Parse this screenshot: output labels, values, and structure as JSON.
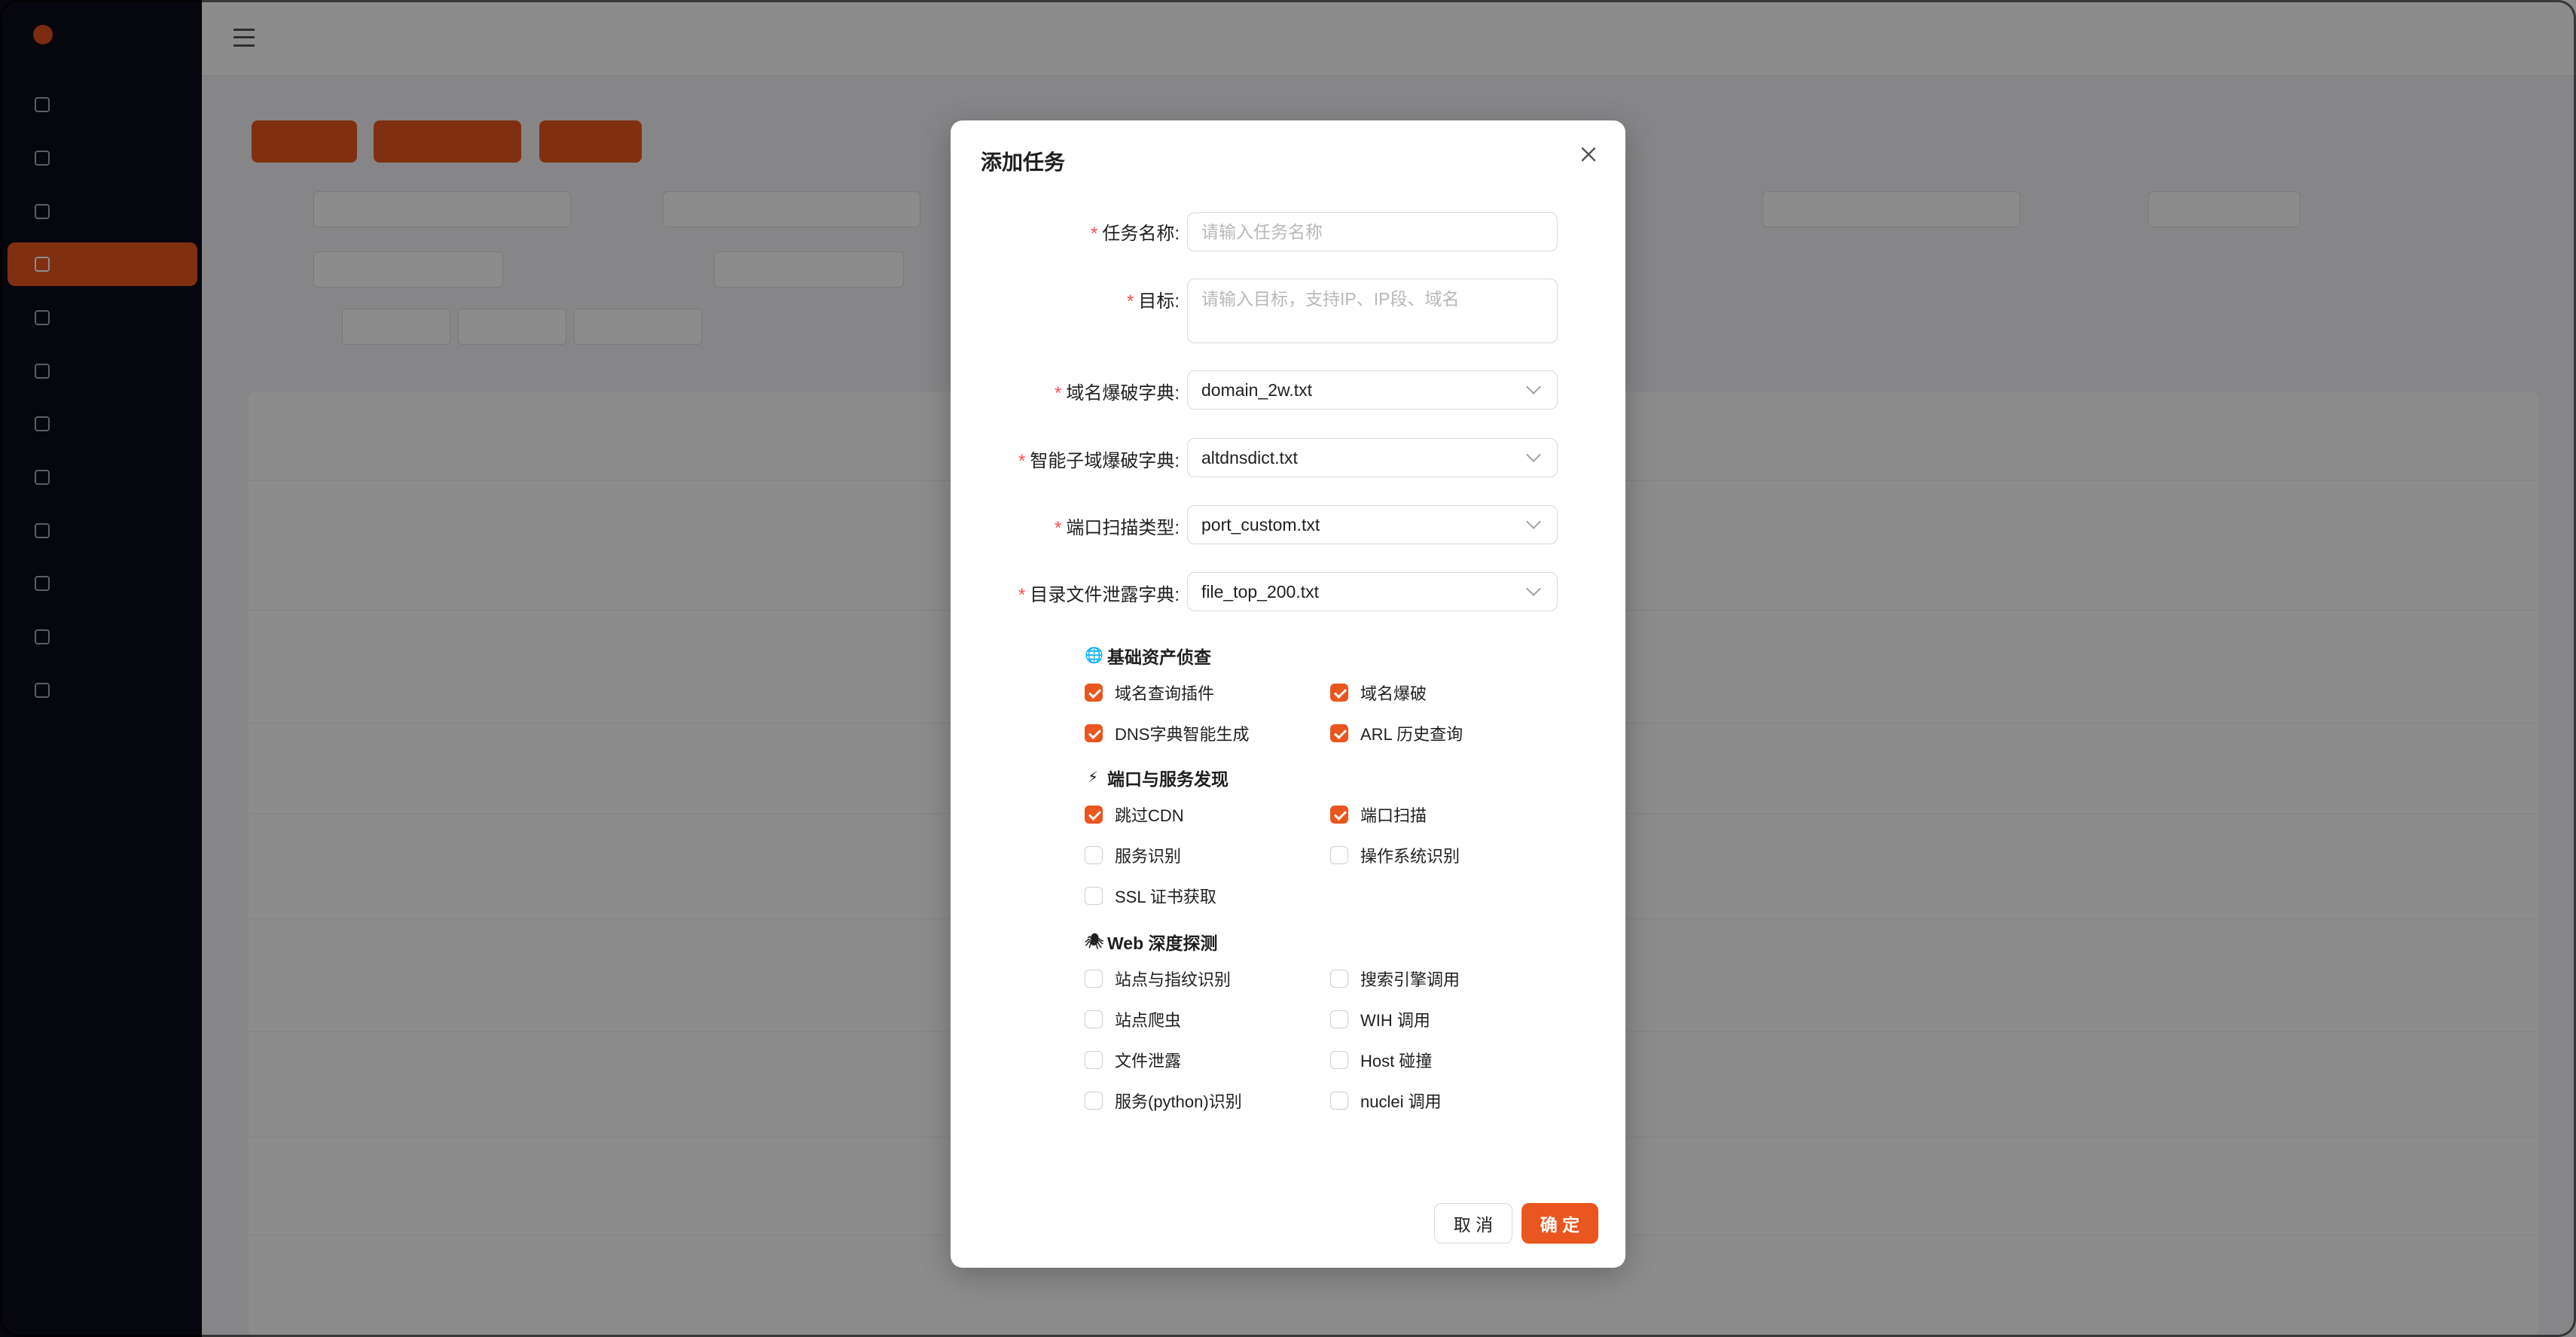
{
  "modal": {
    "title": "添加任务",
    "fields": {
      "name": {
        "label": "任务名称",
        "placeholder": "请输入任务名称"
      },
      "target": {
        "label": "目标",
        "placeholder": "请输入目标，支持IP、IP段、域名"
      },
      "domain_dict": {
        "label": "域名爆破字典",
        "value": "domain_2w.txt"
      },
      "smart_dict": {
        "label": "智能子域爆破字典",
        "value": "altdnsdict.txt"
      },
      "port_type": {
        "label": "端口扫描类型",
        "value": "port_custom.txt"
      },
      "dir_dict": {
        "label": "目录文件泄露字典",
        "value": "file_top_200.txt"
      }
    },
    "sections": [
      {
        "title": "基础资产侦查",
        "icon": "globe-icon",
        "icon_glyph": "🌐",
        "options": [
          {
            "label": "域名查询插件",
            "checked": true
          },
          {
            "label": "域名爆破",
            "checked": true
          },
          {
            "label": "DNS字典智能生成",
            "checked": true
          },
          {
            "label": "ARL 历史查询",
            "checked": true
          }
        ]
      },
      {
        "title": "端口与服务发现",
        "icon": "lightning-icon",
        "icon_glyph": "⚡",
        "options": [
          {
            "label": "跳过CDN",
            "checked": true
          },
          {
            "label": "端口扫描",
            "checked": true
          },
          {
            "label": "服务识别",
            "checked": false
          },
          {
            "label": "操作系统识别",
            "checked": false
          },
          {
            "label": "SSL 证书获取",
            "checked": false
          }
        ]
      },
      {
        "title": "Web 深度探测",
        "icon": "spider-icon",
        "icon_glyph": "🕷",
        "options": [
          {
            "label": "站点与指纹识别",
            "checked": false
          },
          {
            "label": "搜索引擎调用",
            "checked": false
          },
          {
            "label": "站点爬虫",
            "checked": false
          },
          {
            "label": "WIH 调用",
            "checked": false
          },
          {
            "label": "文件泄露",
            "checked": false
          },
          {
            "label": "Host 碰撞",
            "checked": false
          },
          {
            "label": "服务(python)识别",
            "checked": false
          },
          {
            "label": "nuclei 调用",
            "checked": false
          }
        ]
      }
    ],
    "cancel_label": "取 消",
    "ok_label": "确 定"
  },
  "colors": {
    "accent": "#e9561f",
    "required": "#ff4d4f"
  }
}
